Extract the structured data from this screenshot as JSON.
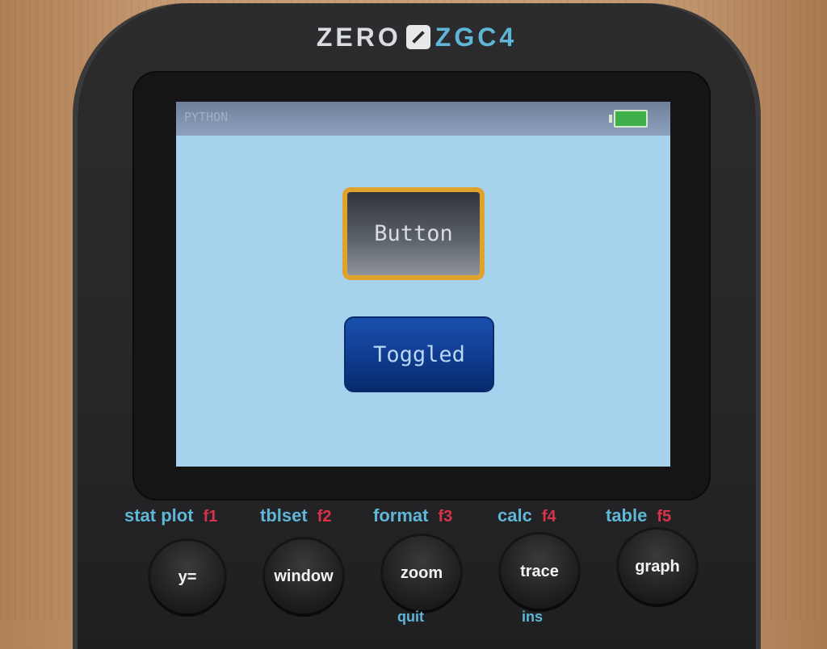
{
  "device": {
    "brand": "ZERO",
    "model": "ZGC4"
  },
  "screen": {
    "status_title": "PYTHON",
    "battery_color": "#3fb04a",
    "background_color": "#a7d2ee",
    "buttons": [
      {
        "label": "Button",
        "state": "focused",
        "border_color": "#e0a22c"
      },
      {
        "label": "Toggled",
        "state": "toggled",
        "fill_color": "#0f3c8e"
      }
    ]
  },
  "function_row": [
    {
      "main": "stat plot",
      "fn": "f1",
      "key": "y="
    },
    {
      "main": "tblset",
      "fn": "f2",
      "key": "window"
    },
    {
      "main": "format",
      "fn": "f3",
      "key": "zoom",
      "sub": "quit"
    },
    {
      "main": "calc",
      "fn": "f4",
      "key": "trace",
      "sub": "ins"
    },
    {
      "main": "table",
      "fn": "f5",
      "key": "graph"
    }
  ],
  "colors": {
    "accent_blue": "#5fb6d6",
    "accent_red": "#d8334a",
    "focus_orange": "#e0a22c"
  }
}
